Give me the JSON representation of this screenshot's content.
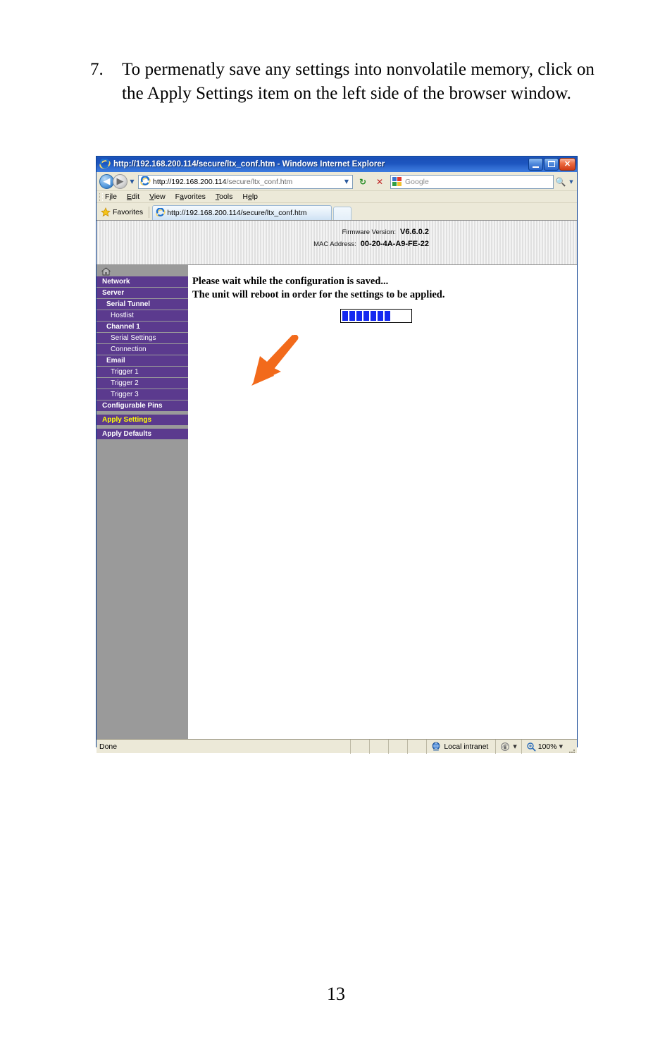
{
  "document": {
    "step_number": "7.",
    "step_text": "To permenatly save any settings into nonvolatile memory, click on the Apply Settings item on the left side of the browser window.",
    "page_number": "13"
  },
  "browser": {
    "title": "http://192.168.200.114/secure/ltx_conf.htm - Windows Internet Explorer",
    "title_icon": "internet-explorer-icon",
    "window_buttons": {
      "minimize": "Minimize",
      "maximize": "Maximize",
      "close": "Close"
    },
    "address_bar": {
      "value_bold": "http://192.168.200.114",
      "value_dim": "/secure/ltx_conf.htm",
      "icon": "internet-explorer-icon"
    },
    "toolbar": {
      "back": "Back",
      "forward": "Forward",
      "history_dropdown": "Recent Pages",
      "refresh": "Refresh",
      "stop": "Stop",
      "search_placeholder": "Google",
      "search_icon": "magnifier-icon",
      "search_provider_icon": "google-icon"
    },
    "menu": [
      {
        "pre": "F",
        "u": "i",
        "post": "le"
      },
      {
        "pre": "",
        "u": "E",
        "post": "dit"
      },
      {
        "pre": "",
        "u": "V",
        "post": "iew"
      },
      {
        "pre": "F",
        "u": "a",
        "post": "vorites"
      },
      {
        "pre": "",
        "u": "T",
        "post": "ools"
      },
      {
        "pre": "H",
        "u": "e",
        "post": "lp"
      }
    ],
    "favorites": {
      "label": "Favorites",
      "icon": "star-icon"
    },
    "tab": {
      "label": "http://192.168.200.114/secure/ltx_conf.htm",
      "icon": "internet-explorer-icon",
      "new_tab_label": ""
    },
    "status": {
      "text": "Done",
      "zone": "Local intranet",
      "zone_icon": "globe-icon",
      "protected_icon": "protected-mode-icon",
      "zoom": "100%",
      "zoom_icon": "magnifier-plus-icon"
    }
  },
  "device_page": {
    "header": {
      "firmware_label": "Firmware Version:",
      "firmware_value": "V6.6.0.2",
      "mac_label": "MAC Address:",
      "mac_value": "00-20-4A-A9-FE-22"
    },
    "sidebar": {
      "home_icon": "home-icon",
      "items": [
        {
          "label": "Network",
          "level": 0,
          "selected": false
        },
        {
          "label": "Server",
          "level": 0,
          "selected": false
        },
        {
          "label": "Serial Tunnel",
          "level": 1,
          "selected": false
        },
        {
          "label": "Hostlist",
          "level": 2,
          "selected": false
        },
        {
          "label": "Channel 1",
          "level": 1,
          "selected": false
        },
        {
          "label": "Serial Settings",
          "level": 2,
          "selected": false
        },
        {
          "label": "Connection",
          "level": 2,
          "selected": false
        },
        {
          "label": "Email",
          "level": 1,
          "selected": false
        },
        {
          "label": "Trigger 1",
          "level": 2,
          "selected": false
        },
        {
          "label": "Trigger 2",
          "level": 2,
          "selected": false
        },
        {
          "label": "Trigger 3",
          "level": 2,
          "selected": false
        },
        {
          "label": "Configurable Pins",
          "level": 0,
          "selected": false
        },
        {
          "label": "Apply Settings",
          "level": 0,
          "selected": true
        },
        {
          "label": "Apply Defaults",
          "level": 0,
          "selected": false
        }
      ]
    },
    "content": {
      "message_line1": "Please wait while the configuration is saved...",
      "message_line2": "The unit will reboot in order for the settings to be applied.",
      "progress_blocks": 7,
      "progress_total": 11,
      "progress_fill_color": "#1429f0"
    }
  },
  "annotation": {
    "arrow_color": "#f26a1b",
    "arrow_target": "Apply Settings"
  },
  "colors": {
    "sidebar_item": "#5b3a8e",
    "sidebar_bg": "#9a9a9a",
    "selected_text": "#ffff00",
    "titlebar_blue": "#1d55bf",
    "chrome_beige": "#ece9d8"
  }
}
